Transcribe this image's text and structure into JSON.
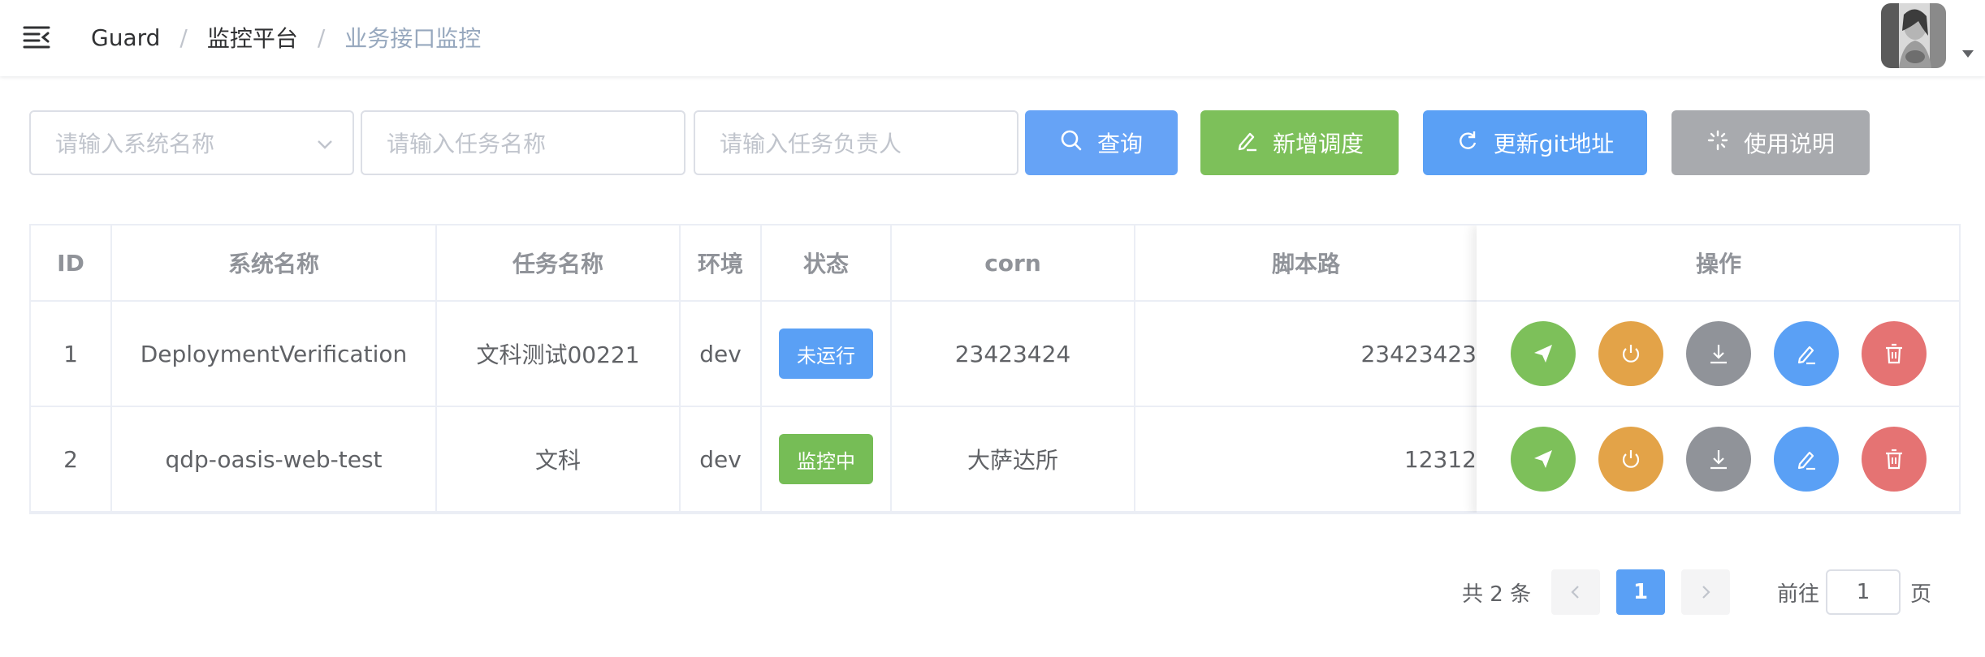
{
  "header": {
    "breadcrumb": [
      "Guard",
      "监控平台",
      "业务接口监控"
    ],
    "separator": "/"
  },
  "filters": {
    "system_placeholder": "请输入系统名称",
    "task_placeholder": "请输入任务名称",
    "owner_placeholder": "请输入任务负责人",
    "query_label": "查询",
    "add_label": "新增调度",
    "update_git_label": "更新git地址",
    "help_label": "使用说明"
  },
  "table": {
    "columns": [
      "ID",
      "系统名称",
      "任务名称",
      "环境",
      "状态",
      "corn",
      "脚本路",
      "操作"
    ],
    "rows": [
      {
        "id": "1",
        "system": "DeploymentVerification",
        "task": "文科测试00221",
        "env": "dev",
        "status": "未运行",
        "status_color": "#5aa0f5",
        "corn": "23423424",
        "script": "23423423"
      },
      {
        "id": "2",
        "system": "qdp-oasis-web-test",
        "task": "文科",
        "env": "dev",
        "status": "监控中",
        "status_color": "#76bd56",
        "corn": "大萨达所",
        "script": "12312"
      }
    ],
    "actions": [
      {
        "icon": "send-icon",
        "color": "#7dc05a"
      },
      {
        "icon": "power-icon",
        "color": "#e3a348"
      },
      {
        "icon": "download-icon",
        "color": "#909399"
      },
      {
        "icon": "edit-icon",
        "color": "#5aa0f5"
      },
      {
        "icon": "delete-icon",
        "color": "#e57373"
      }
    ]
  },
  "pagination": {
    "total_text": "共 2 条",
    "current_page": "1",
    "goto_label": "前往",
    "goto_value": "1",
    "page_suffix": "页"
  },
  "colors": {
    "primary": "#5aa0f5",
    "success": "#7dc05a",
    "warning": "#e3a348",
    "info": "#a8aaae",
    "danger": "#e57373"
  }
}
